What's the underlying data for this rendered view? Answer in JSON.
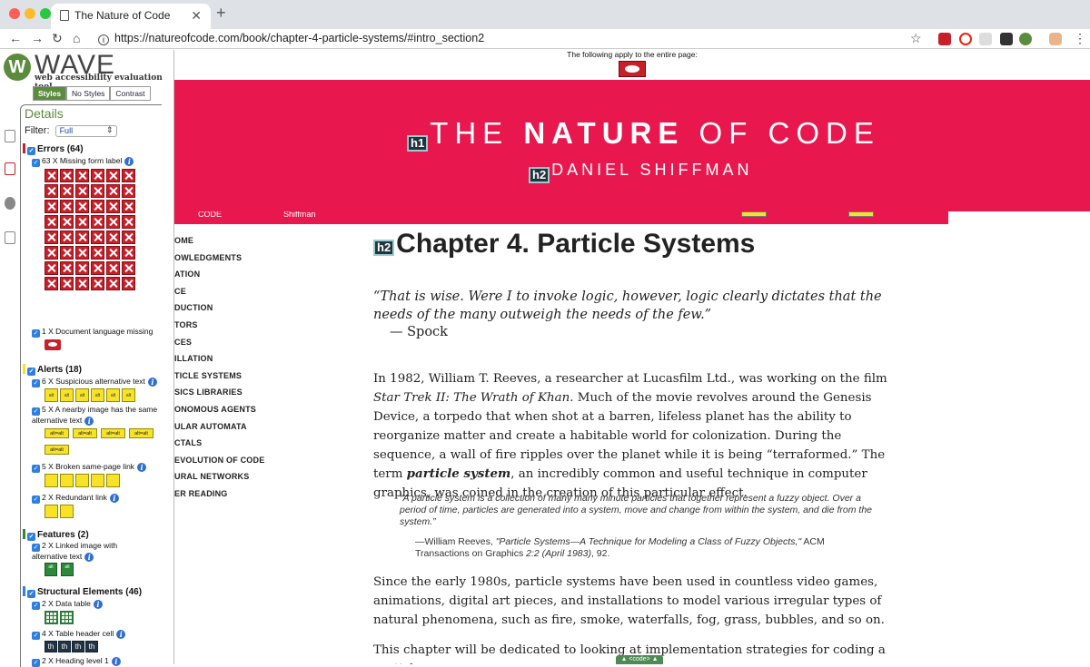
{
  "browser": {
    "tab_title": "The Nature of Code",
    "url": "https://natureofcode.com/book/chapter-4-particle-systems/#intro_section2"
  },
  "wave": {
    "logo_letter": "W",
    "title": "WAVE",
    "subtitle": "web accessibility evaluation tool",
    "tabs": [
      "Styles",
      "No Styles",
      "Contrast"
    ],
    "details_title": "Details",
    "filter_label": "Filter:",
    "filter_value": "Full",
    "errors_head": "Errors (64)",
    "errors_items": [
      "63 X Missing form label",
      "1 X Document language missing"
    ],
    "alerts_head": "Alerts (18)",
    "alerts_items": [
      "6 X Suspicious alternative text",
      "5 X A nearby image has the same alternative text",
      "5 X Broken same-page link",
      "2 X Redundant link"
    ],
    "alt_label": "alt",
    "alt_eq_label": "alt=alt",
    "features_head": "Features (2)",
    "features_items": [
      "2 X Linked image with alternative text"
    ],
    "structural_head": "Structural Elements (46)",
    "structural_items": [
      "2 X Data table",
      "4 X Table header cell",
      "2 X Heading level 1"
    ],
    "th_label": "th",
    "colors": {
      "error": "#c8202a",
      "alert": "#f5e229",
      "feature": "#2b8a3a",
      "structure": "#2f7fe0",
      "accent": "#5b8c3e"
    }
  },
  "page": {
    "notice": "The following apply to the entire page:",
    "title_light_1": "THE ",
    "title_bold": "NATURE",
    "title_light_2": " OF CODE",
    "subtitle": "DANIEL SHIFFMAN",
    "h1_badge": "h1",
    "h2_badge": "h2",
    "peek_left": "CODE",
    "peek_mid": "Shiffman",
    "toc": [
      "OME",
      "OWLEDGMENTS",
      "ATION",
      "CE",
      "DUCTION",
      "TORS",
      "CES",
      "ILLATION",
      "TICLE SYSTEMS",
      "SICS LIBRARIES",
      "ONOMOUS AGENTS",
      "ULAR AUTOMATA",
      "CTALS",
      "EVOLUTION OF CODE",
      "URAL NETWORKS",
      "ER READING"
    ],
    "chapter_title": "Chapter 4. Particle Systems",
    "quote": "“That is wise. Were I to invoke logic, however, logic clearly dictates that the needs of the many outweigh the needs of the few.”",
    "quote_by": "— Spock",
    "p1_a": "In 1982, William T. Reeves, a researcher at Lucasfilm Ltd., was working on the film ",
    "p1_film": "Star Trek II: The Wrath of Khan",
    "p1_b": ". Much of the movie revolves around the Genesis Device, a torpedo that when shot at a barren, lifeless planet has the ability to reorganize matter and create a habitable world for colonization. During the sequence, a wall of fire ripples over the planet while it is being “terraformed.” The term ",
    "p1_term": "particle system",
    "p1_c": ", an incredibly common and useful technique in computer graphics, was coined in the creation of this particular effect.",
    "blockquote": "“A particle system is a collection of many many minute particles that together represent a fuzzy object. Over a period of time, particles are generated into a system, move and change from within the system, and die from the system.”",
    "blockquote_by_a": "—William Reeves, ",
    "blockquote_by_i": "\"Particle Systems—A Technique for Modeling a Class of Fuzzy Objects,\"",
    "blockquote_by_b": " ACM Transactions on Graphics ",
    "blockquote_by_c": "2:2 (April 1983)",
    "blockquote_by_d": ", 92.",
    "p2": "Since the early 1980s, particle systems have been used in countless video games, animations, digital art pieces, and installations to model various irregular types of natural phenomena, such as fire, smoke, waterfalls, fog, grass, bubbles, and so on.",
    "p3": "This chapter will be dedicated to looking at implementation strategies for coding a particle",
    "code_tab": "▲ <code> ▲"
  }
}
